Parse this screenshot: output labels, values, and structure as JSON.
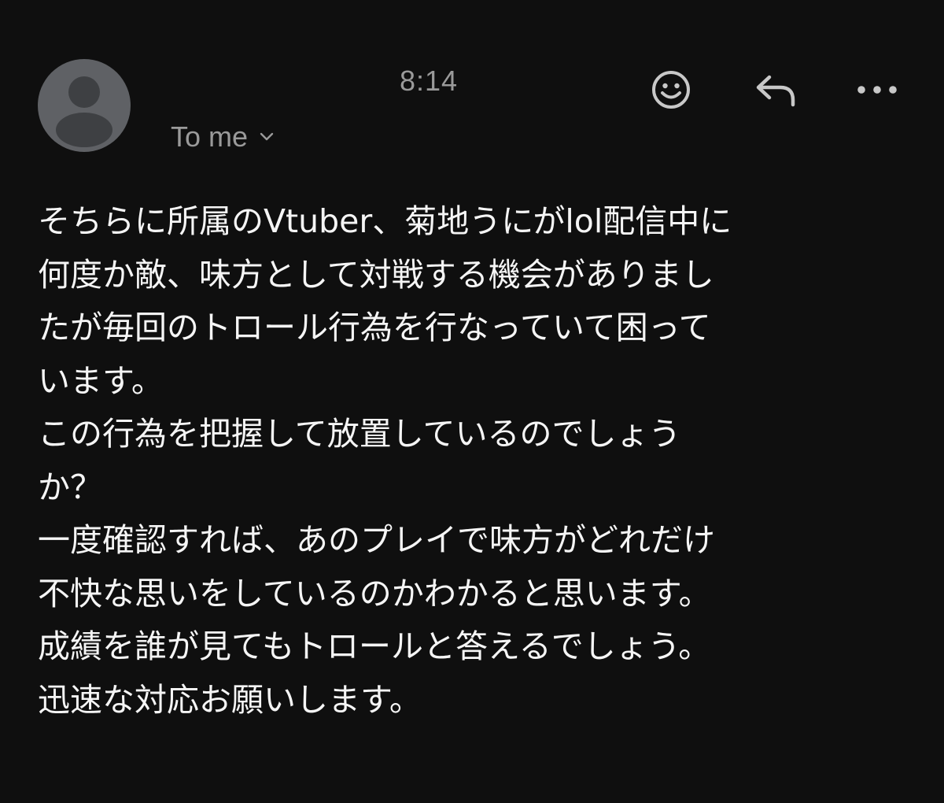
{
  "header": {
    "time": "8:14",
    "recipient_label": "To me",
    "icons": {
      "avatar": "person-icon",
      "expand": "chevron-down-icon",
      "emoji": "smiley-face-icon",
      "reply": "reply-arrow-icon",
      "more": "more-horizontal-icon"
    }
  },
  "message": {
    "lines": [
      "そちらに所属のVtuber、菊地うにがlol配信中に",
      "何度か敵、味方として対戦する機会がありまし",
      "たが毎回のトロール行為を行なっていて困って",
      "います。",
      "この行為を把握して放置しているのでしょう",
      "か？",
      "一度確認すれば、あのプレイで味方がどれだけ",
      "不快な思いをしているのかわかると思います。",
      "成績を誰が見てもトロールと答えるでしょう。",
      "迅速な対応お願いします。"
    ]
  },
  "colors": {
    "background": "#0f0f0f",
    "avatar_bg": "#5f6165",
    "avatar_figure": "#3e4043",
    "muted_text": "#9a9a9a",
    "body_text": "#f5f5f5",
    "icon": "#c8c8c8"
  }
}
